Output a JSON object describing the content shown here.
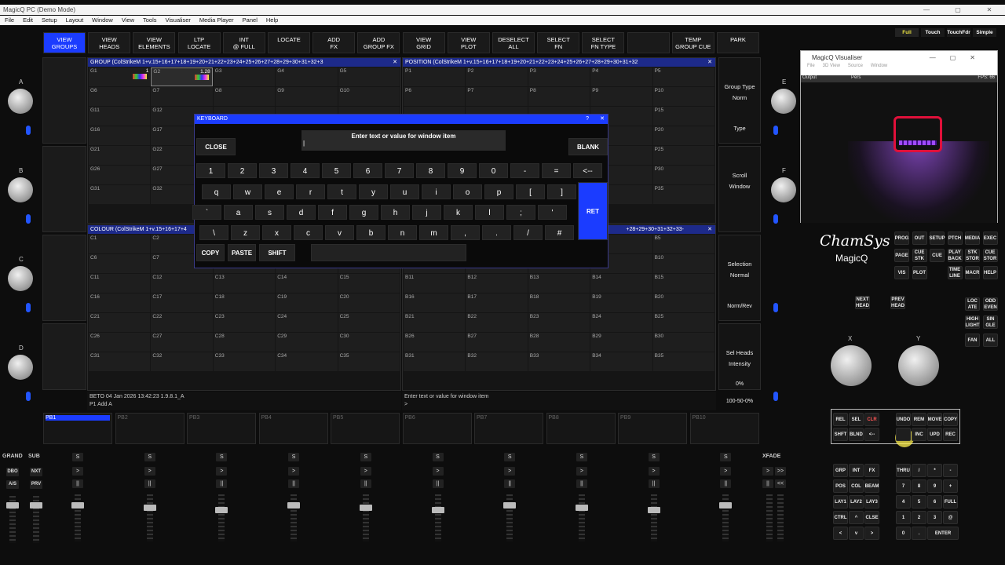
{
  "app": {
    "title": "MagicQ PC (Demo Mode)",
    "window_controls": [
      "—",
      "▢",
      "✕"
    ]
  },
  "menu": [
    "File",
    "Edit",
    "Setup",
    "Layout",
    "Window",
    "View",
    "Tools",
    "Visualiser",
    "Media Player",
    "Panel",
    "Help"
  ],
  "mode_buttons": [
    "Full",
    "Touch",
    "TouchFdr",
    "Simple"
  ],
  "top_buttons": [
    [
      "VIEW",
      "GROUPS"
    ],
    [
      "VIEW",
      "HEADS"
    ],
    [
      "VIEW",
      "ELEMENTS"
    ],
    [
      "LTP",
      "LOCATE"
    ],
    [
      "INT",
      "@ FULL"
    ],
    [
      "LOCATE",
      ""
    ],
    [
      "ADD",
      "FX"
    ],
    [
      "ADD",
      "GROUP FX"
    ],
    [
      "VIEW",
      "GRID"
    ],
    [
      "VIEW",
      "PLOT"
    ],
    [
      "DESELECT",
      "ALL"
    ],
    [
      "SELECT",
      "FN"
    ],
    [
      "SELECT",
      "FN TYPE"
    ],
    [
      "",
      ""
    ],
    [
      "TEMP",
      "GROUP CUE"
    ],
    [
      "PARK",
      ""
    ]
  ],
  "encoder_letters": [
    "A",
    "B",
    "C",
    "D",
    "E",
    "F"
  ],
  "group_window": {
    "title": "GROUP (ColStrikeM 1+v.15+16+17+18+19+20+21+22+23+24+25+26+27+28+29+30+31+32+3",
    "close": "✕",
    "cells": [
      "G1",
      "G2",
      "G3",
      "G4",
      "G5",
      "G6",
      "G7",
      "G8",
      "G9",
      "G10",
      "G11",
      "G12",
      "",
      "",
      "",
      "G16",
      "G17",
      "",
      "",
      "",
      "G21",
      "G22",
      "",
      "",
      "",
      "G26",
      "G27",
      "",
      "",
      "",
      "G31",
      "G32",
      "",
      "",
      ""
    ],
    "g1_count": "1",
    "g2_level": "1.28"
  },
  "position_window": {
    "title": "POSITION (ColStrikeM 1+v.15+16+17+18+19+20+21+22+23+24+25+26+27+28+29+30+31+32",
    "close": "✕",
    "cells": [
      "P1",
      "P2",
      "P3",
      "P4",
      "P5",
      "P6",
      "P7",
      "P8",
      "P9",
      "P10",
      "",
      "",
      "",
      "",
      "P15",
      "",
      "",
      "",
      "",
      "P20",
      "",
      "",
      "",
      "",
      "P25",
      "",
      "",
      "",
      "",
      "P30",
      "",
      "",
      "",
      "",
      "P35"
    ]
  },
  "colour_window": {
    "title": "COLOUR (ColStrikeM 1+v.15+16+17+4",
    "close": "✕",
    "cells": [
      "C1",
      "C2",
      "",
      "",
      "",
      "C6",
      "C7",
      "",
      "",
      "",
      "C11",
      "C12",
      "C13",
      "C14",
      "C15",
      "C16",
      "C17",
      "C18",
      "C19",
      "C20",
      "C21",
      "C22",
      "C23",
      "C24",
      "C25",
      "C26",
      "C27",
      "C28",
      "C29",
      "C30",
      "C31",
      "C32",
      "C33",
      "C34",
      "C35"
    ]
  },
  "beam_window": {
    "title": "+28+29+30+31+32+33-",
    "close": "✕",
    "cells": [
      "",
      "",
      "",
      "",
      "B5",
      "",
      "",
      "",
      "",
      "B10",
      "B11",
      "B12",
      "B13",
      "B14",
      "B15",
      "B16",
      "B17",
      "B18",
      "B19",
      "B20",
      "B21",
      "B22",
      "B23",
      "B24",
      "B25",
      "B26",
      "B27",
      "B28",
      "B29",
      "B30",
      "B31",
      "B32",
      "B33",
      "B34",
      "B35"
    ]
  },
  "right_soft": [
    {
      "l1": "Group Type",
      "l2": "Norm",
      "l3": "Type"
    },
    {
      "l1": "Scroll",
      "l2": "Window",
      "l3": ""
    },
    {
      "l1": "Selection",
      "l2": "Normal",
      "l3": "Norm/Rev"
    },
    {
      "l1": "Sel Heads",
      "l2": "Intensity",
      "l3": "0%",
      "l4": "100-50-0%"
    }
  ],
  "status": {
    "left": "BETO 04 Jan 2026 13:42:23 1.9.8.1_A",
    "left2": "P1  Add A",
    "right": "Enter text or value for window item",
    "right2": ">"
  },
  "keyboard": {
    "title": "KEYBOARD",
    "help": "?",
    "close_x": "✕",
    "prompt": "Enter text or value for window item",
    "input_value": "|",
    "close": "CLOSE",
    "blank": "BLANK",
    "ret": "RET",
    "copy": "COPY",
    "paste": "PASTE",
    "shift": "SHIFT",
    "row1": [
      "1",
      "2",
      "3",
      "4",
      "5",
      "6",
      "7",
      "8",
      "9",
      "0",
      "-",
      "=",
      "<--"
    ],
    "row2": [
      "q",
      "w",
      "e",
      "r",
      "t",
      "y",
      "u",
      "i",
      "o",
      "p",
      "[",
      "]"
    ],
    "row3": [
      "`",
      "a",
      "s",
      "d",
      "f",
      "g",
      "h",
      "j",
      "k",
      "l",
      ";",
      "'"
    ],
    "row4": [
      "\\",
      "z",
      "x",
      "c",
      "v",
      "b",
      "n",
      "m",
      ",",
      ".",
      "/",
      "#"
    ]
  },
  "playbacks": [
    "PB1",
    "PB2",
    "PB3",
    "PB4",
    "PB5",
    "PB6",
    "PB7",
    "PB8",
    "PB9",
    "PB10"
  ],
  "fader_labels": {
    "grand": "GRAND",
    "sub": "SUB",
    "dbo": "DBO",
    "nxt": "NXT",
    "as": "A/S",
    "prv": "PRV",
    "xfade": "XFADE",
    "s": "S",
    "go": ">",
    "pause": "||",
    "ffwd": ">>",
    "rew": "<<"
  },
  "visualiser": {
    "title": "MagicQ Visualiser",
    "menu": [
      "File",
      "3D View",
      "Source",
      "Window"
    ],
    "output": "Output",
    "pers": "Pers",
    "fps": "FPS: 66"
  },
  "brand": {
    "name": "ChamSys",
    "sub": "MagicQ"
  },
  "exec_keys": [
    [
      "PROG",
      "OUT",
      "SETUP",
      "PTCH",
      "MEDIA",
      "EXEC"
    ],
    [
      "PAGE",
      "CUE STK",
      "CUE",
      "PLAY BACK",
      "STK STOR",
      "CUE STOR"
    ],
    [
      "VIS",
      "PLOT",
      "",
      "TIME LINE",
      "MACR",
      "HELP"
    ]
  ],
  "misc_keys": {
    "next_head": "NEXT HEAD",
    "prev_head": "PREV HEAD",
    "locate": "LOC ATE",
    "odd_even": "ODD EVEN",
    "high_light": "HIGH LIGHT",
    "single": "SIN GLE",
    "fan": "FAN",
    "all": "ALL",
    "x": "X",
    "y": "Y"
  },
  "edit_keys": [
    [
      "REL",
      "SEL",
      "CLR",
      "",
      "UNDO",
      "REM",
      "MOVE",
      "COPY"
    ],
    [
      "SHFT",
      "BLND",
      "<--",
      "",
      "",
      "INC",
      "UPD",
      "REC"
    ]
  ],
  "keypad": [
    [
      "GRP",
      "INT",
      "FX",
      "",
      "THRU",
      "/",
      "*",
      "-"
    ],
    [
      "POS",
      "COL",
      "BEAM",
      "",
      "7",
      "8",
      "9",
      "+"
    ],
    [
      "LAY1",
      "LAY2",
      "LAY3",
      "",
      "4",
      "5",
      "6",
      "FULL"
    ],
    [
      "CTRL",
      "^",
      "CLSE",
      "",
      "1",
      "2",
      "3",
      "@"
    ],
    [
      "<",
      "v",
      ">",
      "",
      "0",
      ".",
      "ENTER",
      ""
    ]
  ],
  "colors": {
    "accent": "#1b3cff",
    "header": "#1d2a8a"
  }
}
